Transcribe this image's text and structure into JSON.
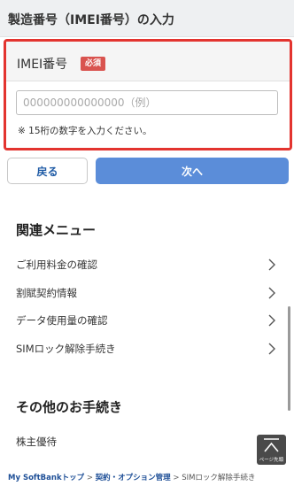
{
  "header": {
    "title": "製造番号（IMEI番号）の入力"
  },
  "imei": {
    "label": "IMEI番号",
    "required_badge": "必須",
    "input_value": "",
    "input_placeholder": "000000000000000（例）",
    "note": "※ 15桁の数字を入力ください。"
  },
  "buttons": {
    "back": "戻る",
    "next": "次へ"
  },
  "related_menu": {
    "title": "関連メニュー",
    "items": [
      {
        "label": "ご利用料金の確認",
        "icon": "chevron-right-icon"
      },
      {
        "label": "割賦契約情報",
        "icon": "chevron-right-icon"
      },
      {
        "label": "データ使用量の確認",
        "icon": "chevron-right-icon"
      },
      {
        "label": "SIMロック解除手続き",
        "icon": "chevron-right-icon"
      }
    ]
  },
  "other_procedures": {
    "title": "その他のお手続き",
    "items": [
      {
        "label": "株主優待"
      }
    ]
  },
  "page_top": {
    "label": "ページ先頭",
    "icon": "arrow-up-icon"
  },
  "breadcrumb": {
    "items": [
      {
        "label": "My SoftBankトップ"
      },
      {
        "label": "契約・オプション管理"
      },
      {
        "label": "SIMロック解除手続き"
      }
    ],
    "separator": ">"
  },
  "colors": {
    "highlight_border": "#e3342f",
    "required_badge": "#d9534f",
    "primary_button": "#5b8dd9",
    "link": "#1e4f97"
  }
}
